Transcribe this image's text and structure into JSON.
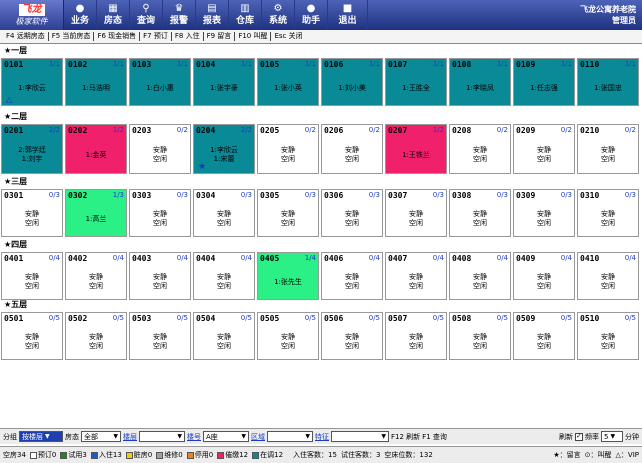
{
  "app": {
    "logo_top": "飞龙",
    "logo_bottom": "极家软件",
    "org": "飞龙公寓养老院",
    "user": "管理员"
  },
  "toolbar": [
    {
      "icon": "●",
      "label": "业务"
    },
    {
      "icon": "▦",
      "label": "房态"
    },
    {
      "icon": "⚲",
      "label": "查询"
    },
    {
      "icon": "♛",
      "label": "报警"
    },
    {
      "icon": "▤",
      "label": "报表"
    },
    {
      "icon": "▥",
      "label": "仓库"
    },
    {
      "icon": "⚙",
      "label": "系统"
    },
    {
      "icon": "●",
      "label": "助手"
    },
    {
      "icon": "■",
      "label": "退出"
    }
  ],
  "shortcuts": [
    "F4 远期房态",
    "F5 当前房态",
    "F6 现金销售",
    "F7 预订",
    "F8 入住",
    "F9 留言",
    "F10 叫醒",
    "Esc 关闭"
  ],
  "floors": [
    {
      "label": "★一层",
      "rooms": [
        {
          "num": "0101",
          "occ": "1/1",
          "lines": [
            "1:李欣云"
          ],
          "state": "occupied",
          "mark": "pin"
        },
        {
          "num": "0102",
          "occ": "1/1",
          "lines": [
            "1:马浩明"
          ],
          "state": "occupied"
        },
        {
          "num": "0103",
          "occ": "1/1",
          "lines": [
            "1:白小惠"
          ],
          "state": "occupied"
        },
        {
          "num": "0104",
          "occ": "1/1",
          "lines": [
            "1:张宇豪"
          ],
          "state": "occupied"
        },
        {
          "num": "0105",
          "occ": "1/1",
          "lines": [
            "1:张小英"
          ],
          "state": "occupied"
        },
        {
          "num": "0106",
          "occ": "1/1",
          "lines": [
            "1:刘小美"
          ],
          "state": "occupied"
        },
        {
          "num": "0107",
          "occ": "1/1",
          "lines": [
            "1:王胜全"
          ],
          "state": "occupied"
        },
        {
          "num": "0108",
          "occ": "1/1",
          "lines": [
            "1:李晓凤"
          ],
          "state": "occupied"
        },
        {
          "num": "0109",
          "occ": "1/1",
          "lines": [
            "1:任志强"
          ],
          "state": "occupied"
        },
        {
          "num": "0110",
          "occ": "1/1",
          "lines": [
            "1:张国忠"
          ],
          "state": "occupied"
        }
      ]
    },
    {
      "label": "★二层",
      "rooms": [
        {
          "num": "0201",
          "occ": "2/2",
          "lines": [
            "2:郭学廷",
            "1:刘宇"
          ],
          "state": "occupied"
        },
        {
          "num": "0202",
          "occ": "1/2",
          "lines": [
            "1:金英"
          ],
          "state": "dirty"
        },
        {
          "num": "0203",
          "occ": "0/2",
          "lines": [
            "安静",
            "空闲"
          ],
          "state": "free"
        },
        {
          "num": "0204",
          "occ": "2/2",
          "lines": [
            "1:李欣云",
            "1:宋蕾"
          ],
          "state": "occupied",
          "mark": "star"
        },
        {
          "num": "0205",
          "occ": "0/2",
          "lines": [
            "安静",
            "空闲"
          ],
          "state": "free"
        },
        {
          "num": "0206",
          "occ": "0/2",
          "lines": [
            "安静",
            "空闲"
          ],
          "state": "free"
        },
        {
          "num": "0207",
          "occ": "1/2",
          "lines": [
            "1:王铁兰"
          ],
          "state": "dirty"
        },
        {
          "num": "0208",
          "occ": "0/2",
          "lines": [
            "安静",
            "空闲"
          ],
          "state": "free"
        },
        {
          "num": "0209",
          "occ": "0/2",
          "lines": [
            "安静",
            "空闲"
          ],
          "state": "free"
        },
        {
          "num": "0210",
          "occ": "0/2",
          "lines": [
            "安静",
            "空闲"
          ],
          "state": "free"
        }
      ]
    },
    {
      "label": "★三层",
      "rooms": [
        {
          "num": "0301",
          "occ": "0/3",
          "lines": [
            "安静",
            "空闲"
          ],
          "state": "free"
        },
        {
          "num": "0302",
          "occ": "1/3",
          "lines": [
            "1:高兰"
          ],
          "state": "trial"
        },
        {
          "num": "0303",
          "occ": "0/3",
          "lines": [
            "安静",
            "空闲"
          ],
          "state": "free"
        },
        {
          "num": "0304",
          "occ": "0/3",
          "lines": [
            "安静",
            "空闲"
          ],
          "state": "free"
        },
        {
          "num": "0305",
          "occ": "0/3",
          "lines": [
            "安静",
            "空闲"
          ],
          "state": "free"
        },
        {
          "num": "0306",
          "occ": "0/3",
          "lines": [
            "安静",
            "空闲"
          ],
          "state": "free"
        },
        {
          "num": "0307",
          "occ": "0/3",
          "lines": [
            "安静",
            "空闲"
          ],
          "state": "free"
        },
        {
          "num": "0308",
          "occ": "0/3",
          "lines": [
            "安静",
            "空闲"
          ],
          "state": "free"
        },
        {
          "num": "0309",
          "occ": "0/3",
          "lines": [
            "安静",
            "空闲"
          ],
          "state": "free"
        },
        {
          "num": "0310",
          "occ": "0/3",
          "lines": [
            "安静",
            "空闲"
          ],
          "state": "free"
        }
      ]
    },
    {
      "label": "★四层",
      "rooms": [
        {
          "num": "0401",
          "occ": "0/4",
          "lines": [
            "安静",
            "空闲"
          ],
          "state": "free"
        },
        {
          "num": "0402",
          "occ": "0/4",
          "lines": [
            "安静",
            "空闲"
          ],
          "state": "free"
        },
        {
          "num": "0403",
          "occ": "0/4",
          "lines": [
            "安静",
            "空闲"
          ],
          "state": "free"
        },
        {
          "num": "0404",
          "occ": "0/4",
          "lines": [
            "安静",
            "空闲"
          ],
          "state": "free"
        },
        {
          "num": "0405",
          "occ": "1/4",
          "lines": [
            "1:张先生"
          ],
          "state": "trial"
        },
        {
          "num": "0406",
          "occ": "0/4",
          "lines": [
            "安静",
            "空闲"
          ],
          "state": "free"
        },
        {
          "num": "0407",
          "occ": "0/4",
          "lines": [
            "安静",
            "空闲"
          ],
          "state": "free"
        },
        {
          "num": "0408",
          "occ": "0/4",
          "lines": [
            "安静",
            "空闲"
          ],
          "state": "free"
        },
        {
          "num": "0409",
          "occ": "0/4",
          "lines": [
            "安静",
            "空闲"
          ],
          "state": "free"
        },
        {
          "num": "0410",
          "occ": "0/4",
          "lines": [
            "安静",
            "空闲"
          ],
          "state": "free"
        }
      ]
    },
    {
      "label": "★五层",
      "rooms": [
        {
          "num": "0501",
          "occ": "0/5",
          "lines": [
            "安静",
            "空闲"
          ],
          "state": "free"
        },
        {
          "num": "0502",
          "occ": "0/5",
          "lines": [
            "安静",
            "空闲"
          ],
          "state": "free"
        },
        {
          "num": "0503",
          "occ": "0/5",
          "lines": [
            "安静",
            "空闲"
          ],
          "state": "free"
        },
        {
          "num": "0504",
          "occ": "0/5",
          "lines": [
            "安静",
            "空闲"
          ],
          "state": "free"
        },
        {
          "num": "0505",
          "occ": "0/5",
          "lines": [
            "安静",
            "空闲"
          ],
          "state": "free"
        },
        {
          "num": "0506",
          "occ": "0/5",
          "lines": [
            "安静",
            "空闲"
          ],
          "state": "free"
        },
        {
          "num": "0507",
          "occ": "0/5",
          "lines": [
            "安静",
            "空闲"
          ],
          "state": "free"
        },
        {
          "num": "0508",
          "occ": "0/5",
          "lines": [
            "安静",
            "空闲"
          ],
          "state": "free"
        },
        {
          "num": "0509",
          "occ": "0/5",
          "lines": [
            "安静",
            "空闲"
          ],
          "state": "free"
        },
        {
          "num": "0510",
          "occ": "0/5",
          "lines": [
            "安静",
            "空闲"
          ],
          "state": "free"
        }
      ]
    }
  ],
  "filter": {
    "group_label": "分组",
    "group_value": "按楼层",
    "roomtype_label": "房态",
    "roomtype_value": "全部",
    "floor_link": "楼层",
    "building_link": "楼号",
    "building_value": "A座",
    "area_link": "区域",
    "feature_link": "特征",
    "refresh_f12": "F12 刷新",
    "query_f1": "F1 查询",
    "auto_refresh_label": "刷新",
    "rate_label": "频率",
    "rate_value": "5",
    "minutes_label": "分钟"
  },
  "status": {
    "vacant": "空房34",
    "legend": [
      {
        "label": "预订0",
        "color": "#ffffff"
      },
      {
        "label": "试用3",
        "color": "#1a8a1a"
      },
      {
        "label": "入住13",
        "color": "#1a5ccc"
      },
      {
        "label": "脏房0",
        "color": "#f0d000"
      },
      {
        "label": "维修0",
        "color": "#a0a0a0"
      },
      {
        "label": "停用0",
        "color": "#f08020"
      },
      {
        "label": "催缴12",
        "color": "#f0206c"
      },
      {
        "label": "在调12",
        "color": "#0a8a96"
      }
    ],
    "residents": "入住客数：15",
    "trial": "试住客数：3",
    "vacant_beds": "空床位数：132",
    "right_msg": "★：留言",
    "right_wake": "⊙：叫醒",
    "right_vip": "△：VIP"
  },
  "colors": {
    "occupied": "#0a8a96",
    "dirty": "#f0206c",
    "trial": "#2af086",
    "free": "#ffffff"
  }
}
